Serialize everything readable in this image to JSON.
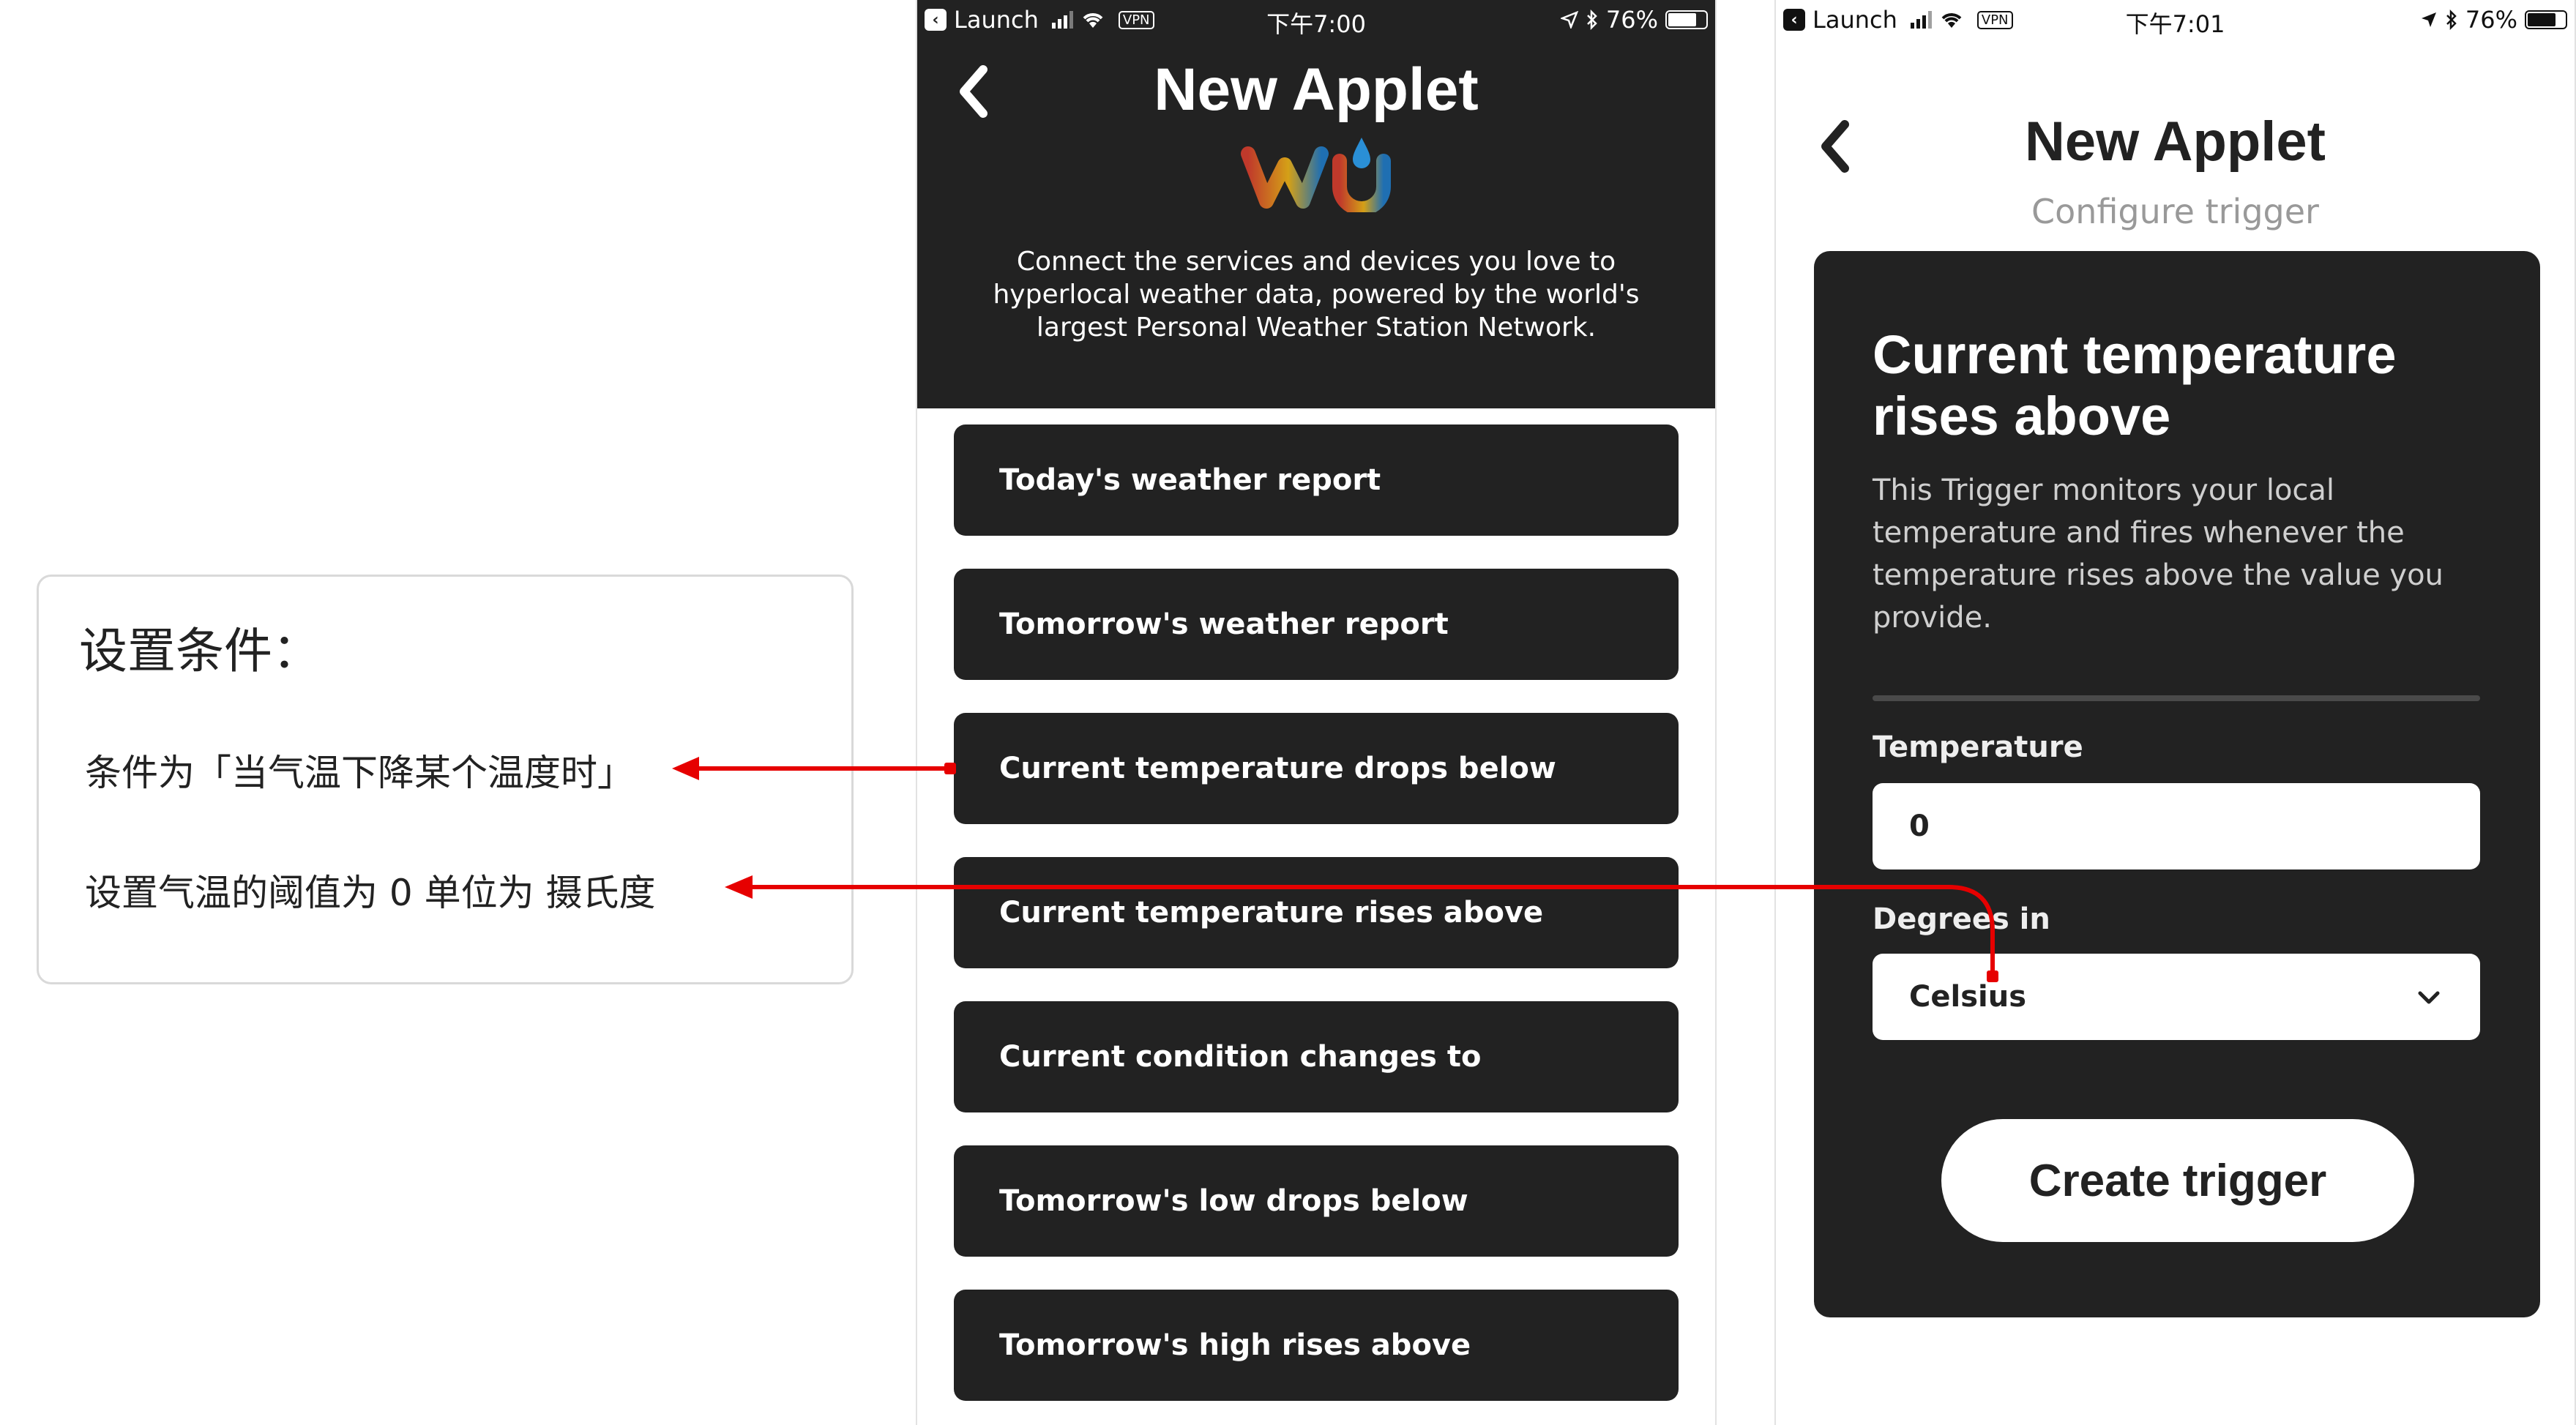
{
  "annotation": {
    "heading": "设置条件：",
    "line1": "条件为「当气温下降某个温度时」",
    "line2": "设置气温的阈值为 0 单位为 摄氏度"
  },
  "screen1": {
    "status": {
      "carrier_back": "Launch",
      "vpn": "VPN",
      "time": "下午7:00",
      "battery": "76%"
    },
    "title": "New Applet",
    "logo_text": "wu",
    "description": "Connect the services and devices you love to hyperlocal weather data, powered by the world's largest Personal Weather Station Network.",
    "triggers": [
      "Today's weather report",
      "Tomorrow's weather report",
      "Current temperature drops below",
      "Current temperature rises above",
      "Current condition changes to",
      "Tomorrow's low drops below",
      "Tomorrow's high rises above"
    ]
  },
  "screen2": {
    "status": {
      "carrier_back": "Launch",
      "vpn": "VPN",
      "time": "下午7:01",
      "battery": "76%"
    },
    "title": "New Applet",
    "subtitle": "Configure trigger",
    "card_title": "Current temperature rises above",
    "card_description": "This Trigger monitors your local temperature and fires whenever the temperature rises above the value you provide.",
    "temperature_label": "Temperature",
    "temperature_value": "0",
    "degrees_label": "Degrees in",
    "degrees_value": "Celsius",
    "create_button": "Create trigger"
  },
  "colors": {
    "dark": "#222222",
    "arrow": "#e60000",
    "muted": "#999999"
  },
  "icons": [
    "back-chevron-icon",
    "signal-icon",
    "wifi-icon",
    "location-icon",
    "bluetooth-icon",
    "battery-icon",
    "chevron-down-icon"
  ]
}
